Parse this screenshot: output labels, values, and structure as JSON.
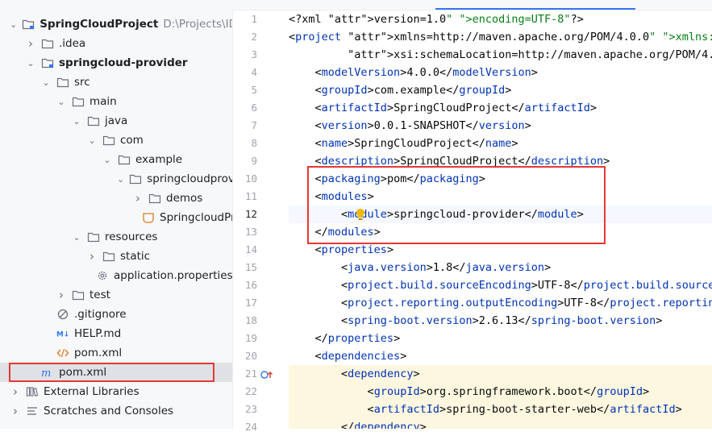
{
  "project_tree": {
    "items": [
      {
        "label": "SpringCloudProject",
        "path": "D:\\Projects\\IDEA\\",
        "indent": 0,
        "expanded": true,
        "icon": "folder-module-icon",
        "bold": true
      },
      {
        "label": ".idea",
        "indent": 1,
        "expanded": false,
        "icon": "folder-icon",
        "bold": false
      },
      {
        "label": "springcloud-provider",
        "indent": 1,
        "expanded": true,
        "icon": "folder-module-icon",
        "bold": true
      },
      {
        "label": "src",
        "indent": 2,
        "expanded": true,
        "icon": "folder-icon",
        "bold": false
      },
      {
        "label": "main",
        "indent": 3,
        "expanded": true,
        "icon": "folder-icon",
        "bold": false
      },
      {
        "label": "java",
        "indent": 4,
        "expanded": true,
        "icon": "folder-icon",
        "bold": false
      },
      {
        "label": "com",
        "indent": 5,
        "expanded": true,
        "icon": "folder-icon",
        "bold": false
      },
      {
        "label": "example",
        "indent": 6,
        "expanded": true,
        "icon": "folder-icon",
        "bold": false
      },
      {
        "label": "springcloudprovi",
        "indent": 7,
        "expanded": true,
        "icon": "folder-icon",
        "bold": false
      },
      {
        "label": "demos",
        "indent": 8,
        "expanded": false,
        "icon": "folder-icon",
        "bold": false
      },
      {
        "label": "SpringcloudPr",
        "indent": 8,
        "leaf": true,
        "icon": "spring-class-icon",
        "bold": false
      },
      {
        "label": "resources",
        "indent": 4,
        "expanded": true,
        "icon": "folder-icon",
        "bold": false
      },
      {
        "label": "static",
        "indent": 5,
        "expanded": false,
        "icon": "folder-icon",
        "bold": false
      },
      {
        "label": "application.properties",
        "indent": 5,
        "leaf": true,
        "icon": "settings-file-icon",
        "bold": false
      },
      {
        "label": "test",
        "indent": 3,
        "expanded": false,
        "icon": "folder-icon",
        "bold": false
      },
      {
        "label": ".gitignore",
        "indent": 2,
        "leaf": true,
        "icon": "gitignore-icon",
        "bold": false
      },
      {
        "label": "HELP.md",
        "indent": 2,
        "leaf": true,
        "icon": "markdown-icon",
        "bold": false
      },
      {
        "label": "pom.xml",
        "indent": 2,
        "leaf": true,
        "icon": "xml-file-icon",
        "bold": false
      },
      {
        "label": "pom.xml",
        "indent": 1,
        "leaf": true,
        "icon": "maven-file-icon",
        "bold": false,
        "selected": true
      },
      {
        "label": "External Libraries",
        "indent": 0,
        "expanded": false,
        "icon": "libraries-icon",
        "bold": false
      },
      {
        "label": "Scratches and Consoles",
        "indent": 0,
        "expanded": false,
        "icon": "scratches-icon",
        "bold": false
      }
    ]
  },
  "editor": {
    "current_line": 12,
    "lines": [
      {
        "n": "1",
        "text": "<?xml version=\"1.0\" encoding=\"UTF-8\"?>"
      },
      {
        "n": "2",
        "text": "<project xmlns=\"http://maven.apache.org/POM/4.0.0\" xmlns:xsi=\"htt"
      },
      {
        "n": "3",
        "text": "         xsi:schemaLocation=\"http://maven.apache.org/POM/4.0.0 ht"
      },
      {
        "n": "4",
        "text": "    <modelVersion>4.0.0</modelVersion>"
      },
      {
        "n": "5",
        "text": "    <groupId>com.example</groupId>"
      },
      {
        "n": "6",
        "text": "    <artifactId>SpringCloudProject</artifactId>"
      },
      {
        "n": "7",
        "text": "    <version>0.0.1-SNAPSHOT</version>"
      },
      {
        "n": "8",
        "text": "    <name>SpringCloudProject</name>"
      },
      {
        "n": "9",
        "text": "    <description>SpringCloudProject</description>"
      },
      {
        "n": "10",
        "text": "    <packaging>pom</packaging>"
      },
      {
        "n": "11",
        "text": "    <modules>"
      },
      {
        "n": "12",
        "text": "        <module>springcloud-provider</module>"
      },
      {
        "n": "13",
        "text": "    </modules>"
      },
      {
        "n": "14",
        "text": "    <properties>"
      },
      {
        "n": "15",
        "text": "        <java.version>1.8</java.version>"
      },
      {
        "n": "16",
        "text": "        <project.build.sourceEncoding>UTF-8</project.build.source"
      },
      {
        "n": "17",
        "text": "        <project.reporting.outputEncoding>UTF-8</project.reportin"
      },
      {
        "n": "18",
        "text": "        <spring-boot.version>2.6.13</spring-boot.version>"
      },
      {
        "n": "19",
        "text": "    </properties>"
      },
      {
        "n": "20",
        "text": "    <dependencies>"
      },
      {
        "n": "21",
        "text": "        <dependency>"
      },
      {
        "n": "22",
        "text": "            <groupId>org.springframework.boot</groupId>"
      },
      {
        "n": "23",
        "text": "            <artifactId>spring-boot-starter-web</artifactId>"
      },
      {
        "n": "24",
        "text": "        </dependency>"
      }
    ]
  },
  "colors": {
    "tag": "#0033b3",
    "attribute": "#174ad4",
    "string": "#067d17",
    "annotation_box": "#e53935",
    "tab_accent": "#3574f0"
  }
}
